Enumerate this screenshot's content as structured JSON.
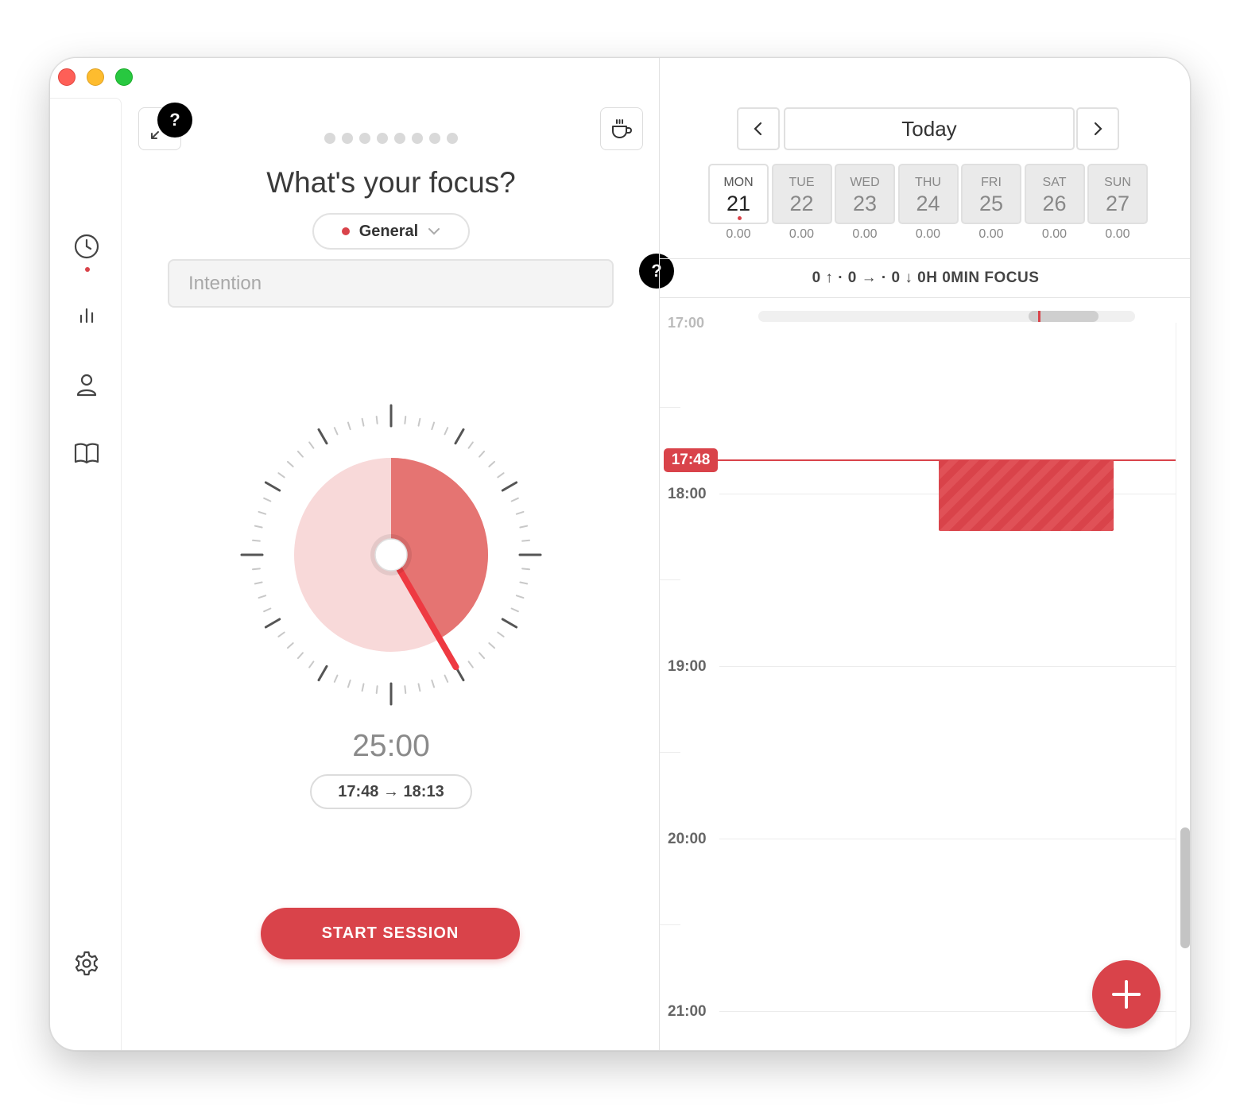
{
  "sidebar": {
    "items": [
      {
        "icon": "clock-icon",
        "active": true
      },
      {
        "icon": "bar-chart-icon"
      },
      {
        "icon": "user-icon"
      },
      {
        "icon": "book-icon"
      }
    ],
    "settings_icon": "gear-icon"
  },
  "focus": {
    "progress_dots": 8,
    "title": "What's your focus?",
    "category_label": "General",
    "category_color": "#d9434a",
    "intention_placeholder": "Intention",
    "help_symbol": "?",
    "timer_display": "25:00",
    "time_range": "17:48 → 18:13",
    "start_label": "START SESSION",
    "dial_duration_minutes": 25,
    "dial_total_minutes": 60
  },
  "calendar": {
    "today_label": "Today",
    "days": [
      {
        "name": "MON",
        "num": "21",
        "score": "0.00",
        "selected": true
      },
      {
        "name": "TUE",
        "num": "22",
        "score": "0.00"
      },
      {
        "name": "WED",
        "num": "23",
        "score": "0.00"
      },
      {
        "name": "THU",
        "num": "24",
        "score": "0.00"
      },
      {
        "name": "FRI",
        "num": "25",
        "score": "0.00"
      },
      {
        "name": "SAT",
        "num": "26",
        "score": "0.00"
      },
      {
        "name": "SUN",
        "num": "27",
        "score": "0.00"
      }
    ],
    "stats": "0 ↑ · 0 → · 0 ↓   0H 0MIN FOCUS",
    "cut_label": "17:00",
    "hours": [
      "18:00",
      "19:00",
      "20:00",
      "21:00"
    ],
    "now_time": "17:48"
  },
  "colors": {
    "accent": "#d9434a",
    "accent_light": "#f7d6d6",
    "accent_mid": "#e57472"
  }
}
